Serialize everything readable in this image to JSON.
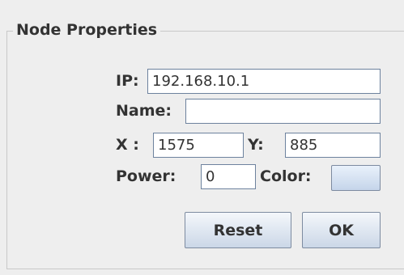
{
  "panel": {
    "title": "Node Properties"
  },
  "fields": {
    "ip": {
      "label": "IP:",
      "value": "192.168.10.1"
    },
    "name": {
      "label": "Name:",
      "value": ""
    },
    "x": {
      "label": "X :",
      "value": "1575"
    },
    "y": {
      "label": "Y:",
      "value": "885"
    },
    "power": {
      "label": "Power:",
      "value": "0"
    },
    "color": {
      "label": "Color:"
    }
  },
  "buttons": {
    "reset": "Reset",
    "ok": "OK"
  },
  "colors": {
    "accent_border": "#6d829e",
    "background": "#eeeeee",
    "text": "#333333"
  }
}
